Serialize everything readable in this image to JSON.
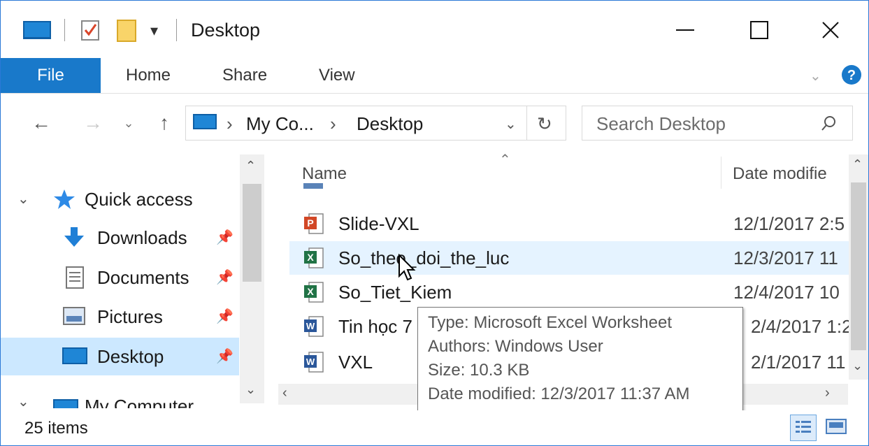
{
  "window": {
    "title": "Desktop"
  },
  "ribbon": {
    "tabs": [
      "File",
      "Home",
      "Share",
      "View"
    ]
  },
  "address": {
    "crumb_root": "My Co...",
    "crumb_current": "Desktop"
  },
  "search": {
    "placeholder": "Search Desktop"
  },
  "nav": {
    "quick_access": "Quick access",
    "items": [
      "Downloads",
      "Documents",
      "Pictures",
      "Desktop"
    ],
    "my_computer": "My Computer"
  },
  "columns": {
    "name": "Name",
    "date": "Date modifie"
  },
  "files": [
    {
      "name": "Slide-VXL",
      "date": "12/1/2017 2:5",
      "type": "ppt"
    },
    {
      "name": "So_theo_doi_the_luc",
      "date": "12/3/2017 11",
      "type": "xls"
    },
    {
      "name": "So_Tiet_Kiem",
      "date": "12/4/2017 10",
      "type": "xls"
    },
    {
      "name": "Tin học 7",
      "date": "2/4/2017 1:2",
      "type": "doc"
    },
    {
      "name": "VXL",
      "date": "2/1/2017 11",
      "type": "doc"
    }
  ],
  "tooltip": {
    "type": "Type: Microsoft Excel Worksheet",
    "authors": "Authors: Windows User",
    "size": "Size: 10.3 KB",
    "modified": "Date modified: 12/3/2017 11:37 AM"
  },
  "status": {
    "count": "25 items"
  },
  "colors": {
    "accent": "#1979ca",
    "selection": "#cce8ff",
    "hover": "#e5f3ff"
  }
}
